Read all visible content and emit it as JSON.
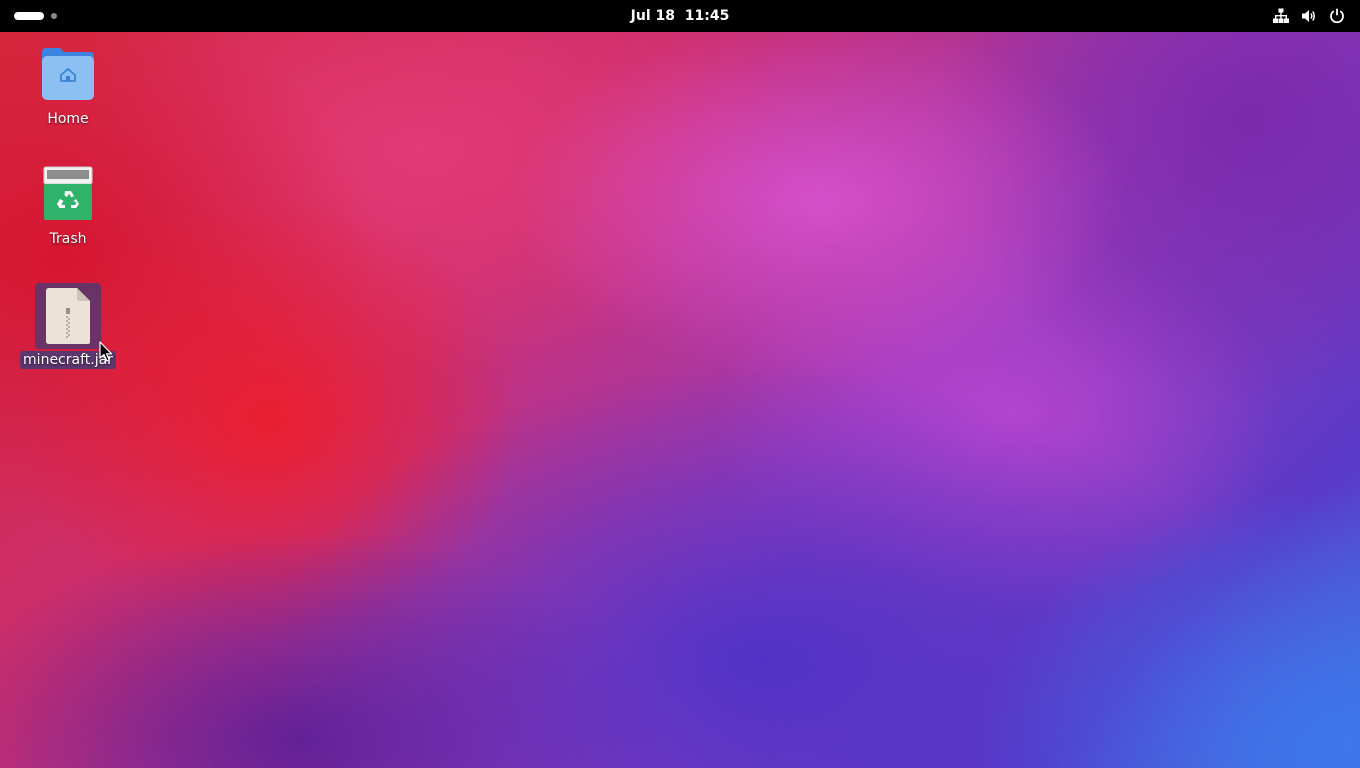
{
  "topbar": {
    "date": "Jul 18",
    "time": "11:45",
    "icons": [
      "network-wired-icon",
      "volume-icon",
      "power-icon"
    ]
  },
  "desktop": {
    "icons": [
      {
        "label": "Home",
        "icon": "home-folder-icon"
      },
      {
        "label": "Trash",
        "icon": "trash-icon"
      },
      {
        "label": "minecraft.jar",
        "icon": "archive-file-icon",
        "selected": true
      }
    ]
  },
  "colors": {
    "topbar_bg": "#000000",
    "folder_blue": "#5aa0f0",
    "trash_green": "#2fb36a",
    "selection": "#463c78"
  }
}
